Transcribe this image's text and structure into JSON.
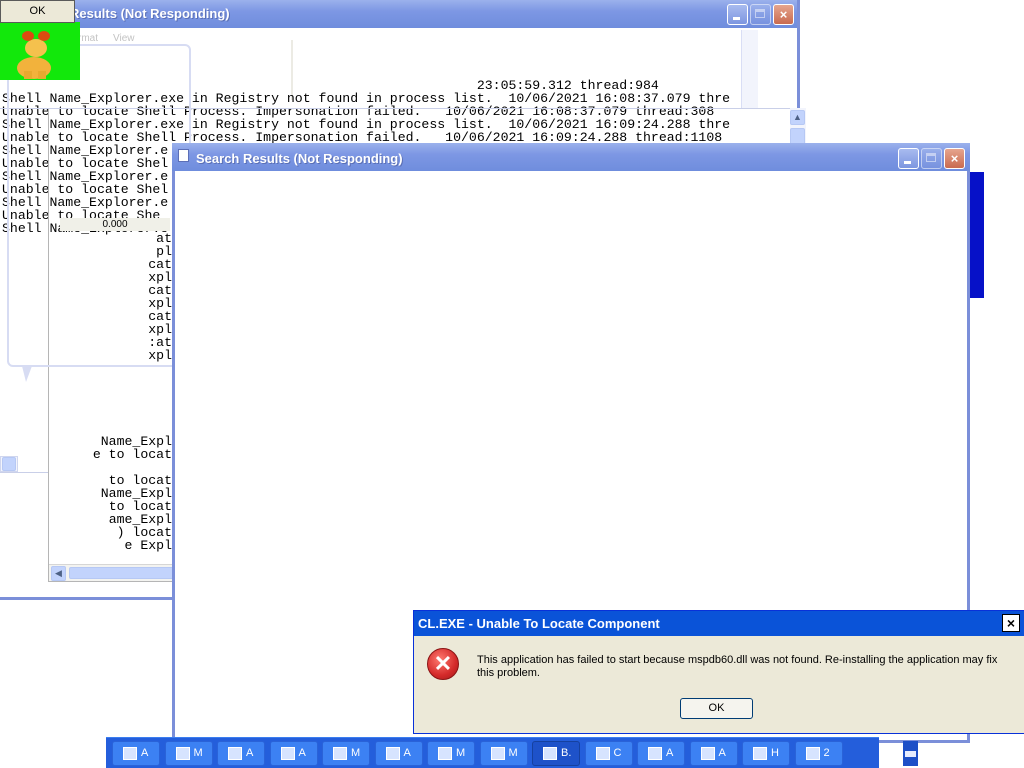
{
  "ok_popup": {
    "label": "OK"
  },
  "back_window": {
    "title": "Results (Not Responding)",
    "menu": {
      "format": "rmat",
      "view": "View"
    },
    "log_head": "                                                            23:05:59.312 thread:984",
    "log_lines": [
      "Shell Name_Explorer.exe in Registry not found in process list.  10/06/2021 16:08:37.079 thre",
      "Unable to locate Shell Process. Impersonation failed.   10/06/2021 16:08:37.079 thread:308",
      "Shell Name_Explorer.exe in Registry not found in process list.  10/06/2021 16:09:24.288 thre",
      "Unable to locate Shell Process. Impersonation failed.   10/06/2021 16:09:24.288 thread:1108",
      "Shell Name_Explorer.e",
      "Unable to locate Shel",
      "Shell Name_Explorer.e",
      "Unable to locate Shel",
      "Shell Name_Explorer.e",
      "Unable to locate She",
      "Shell Name_Explorer.e"
    ],
    "small_value": "0.000",
    "inner_fragments": [
      "at",
      "pl",
      "cat",
      "xpl",
      "cat",
      "xpl",
      "cat",
      "xpl",
      ":at",
      "xpl"
    ],
    "lower_fragments": [
      " Name_Expl",
      "e to locat",
      "",
      " to locat",
      "Name_Expl",
      "to locat",
      "ame_Expl",
      ") locat",
      "e Expl"
    ]
  },
  "front_window": {
    "title": "Search Results (Not Responding)"
  },
  "error_dialog": {
    "title": "CL.EXE - Unable To Locate Component",
    "message": "This application has failed to start because mspdb60.dll was not found. Re-installing the application may fix this problem.",
    "ok_label": "OK",
    "close_glyph": "×"
  },
  "taskbar": {
    "items": [
      {
        "label": "A",
        "icon": "window-icon"
      },
      {
        "label": "M",
        "icon": "network-icon"
      },
      {
        "label": "A",
        "icon": "tools-icon"
      },
      {
        "label": "A",
        "icon": "search-icon"
      },
      {
        "label": "M",
        "icon": "chart-icon"
      },
      {
        "label": "A",
        "icon": "window-icon"
      },
      {
        "label": "M",
        "icon": "film-icon"
      },
      {
        "label": "M",
        "icon": "network-icon"
      },
      {
        "label": "B.",
        "icon": "window-icon"
      },
      {
        "label": "C",
        "icon": "cmd-icon"
      },
      {
        "label": "A",
        "icon": "paint-icon"
      },
      {
        "label": "A",
        "icon": "window-icon"
      },
      {
        "label": "H",
        "icon": "help-icon"
      },
      {
        "label": "2",
        "icon": "window-icon"
      }
    ],
    "tray_icon": "keyboard-icon"
  },
  "colors": {
    "title_gradient": "#7d97e4",
    "window_border": "#7b8fd9",
    "dialog_title": "#0a53d8",
    "taskbar": "#245edb",
    "error_red": "#d42a2a"
  }
}
